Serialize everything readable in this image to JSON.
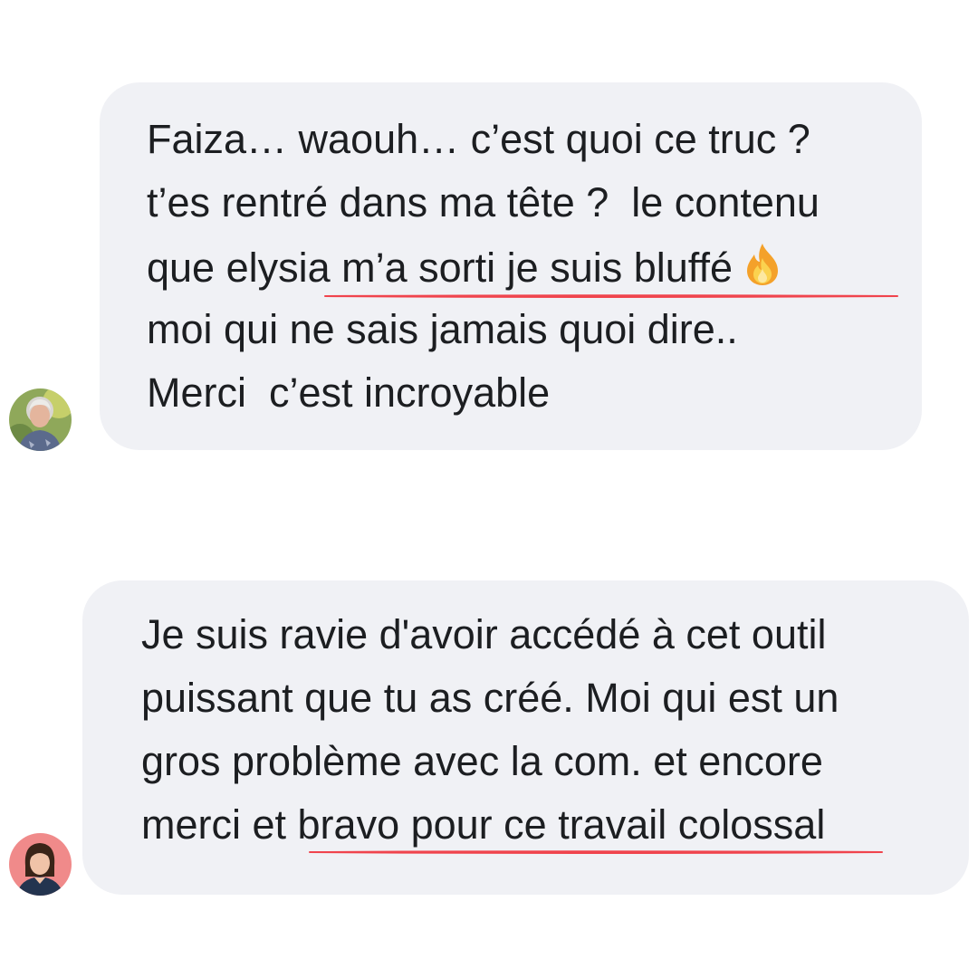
{
  "messages": [
    {
      "lines": [
        "Faiza… waouh… c’est quoi ce truc ?",
        "t’es rentré dans ma tête ?  le contenu",
        "que elysia m’a sorti je suis bluffé",
        "moi qui ne sais jamais quoi dire..",
        "Merci  c’est incroyable"
      ],
      "emoji": "fire-emoji",
      "avatar": "avatar-older-woman"
    },
    {
      "lines": [
        "Je suis ravie d'avoir accédé à cet outil",
        "puissant que tu as créé. Moi qui est un",
        "gros problème avec la com. et encore",
        "merci et bravo pour ce travail colossal"
      ],
      "avatar": "avatar-young-woman"
    }
  ],
  "colors": {
    "bubble": "#f0f1f5",
    "text": "#1c1e21",
    "underline": "#f0444d"
  }
}
